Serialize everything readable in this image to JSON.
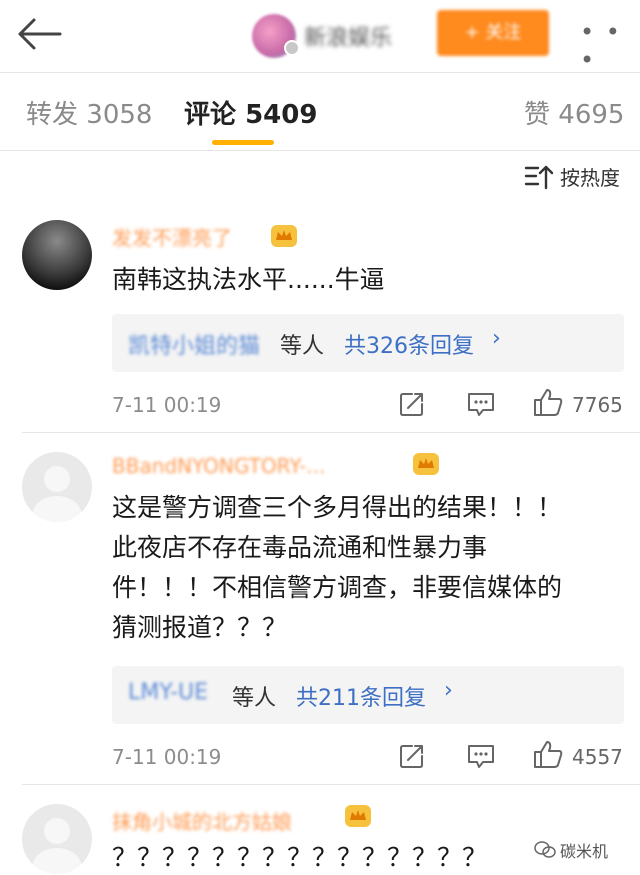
{
  "header": {
    "account_name": "新浪娱乐",
    "follow_label": "+ 关注",
    "more_label": "• • •"
  },
  "tabs": [
    {
      "label": "转发",
      "count": "3058"
    },
    {
      "label": "评论",
      "count": "5409"
    },
    {
      "label": "赞",
      "count": "4695"
    }
  ],
  "sort_label": "按热度",
  "comments": [
    {
      "username": "发发不漂亮了",
      "text": "南韩这执法水平......牛逼",
      "reply_names": "凯特小姐的猫",
      "reply_suffix": "等人",
      "reply_total": "共326条回复",
      "time": "7-11 00:19",
      "likes": "7765"
    },
    {
      "username": "BBandNYONGTORY-...",
      "text_lines": [
        "这是警方调查三个多月得出的结果！！！",
        "此夜店不存在毒品流通和性暴力事",
        "件！！！不相信警方调查，非要信媒体的",
        "猜测报道？？？"
      ],
      "reply_names": "LMY-UE",
      "reply_suffix": "等人",
      "reply_total": "共211条回复",
      "time": "7-11 00:19",
      "likes": "4557"
    },
    {
      "username": "抹角小城的北方姑娘",
      "text": "？？？？？？？？？？？？？？？"
    }
  ],
  "watermark": "碳米机",
  "colors": {
    "follow": "#ff8a1e",
    "tab_underline": "#ffb000",
    "link": "#3d6fc4",
    "username": "#ff9a52"
  }
}
